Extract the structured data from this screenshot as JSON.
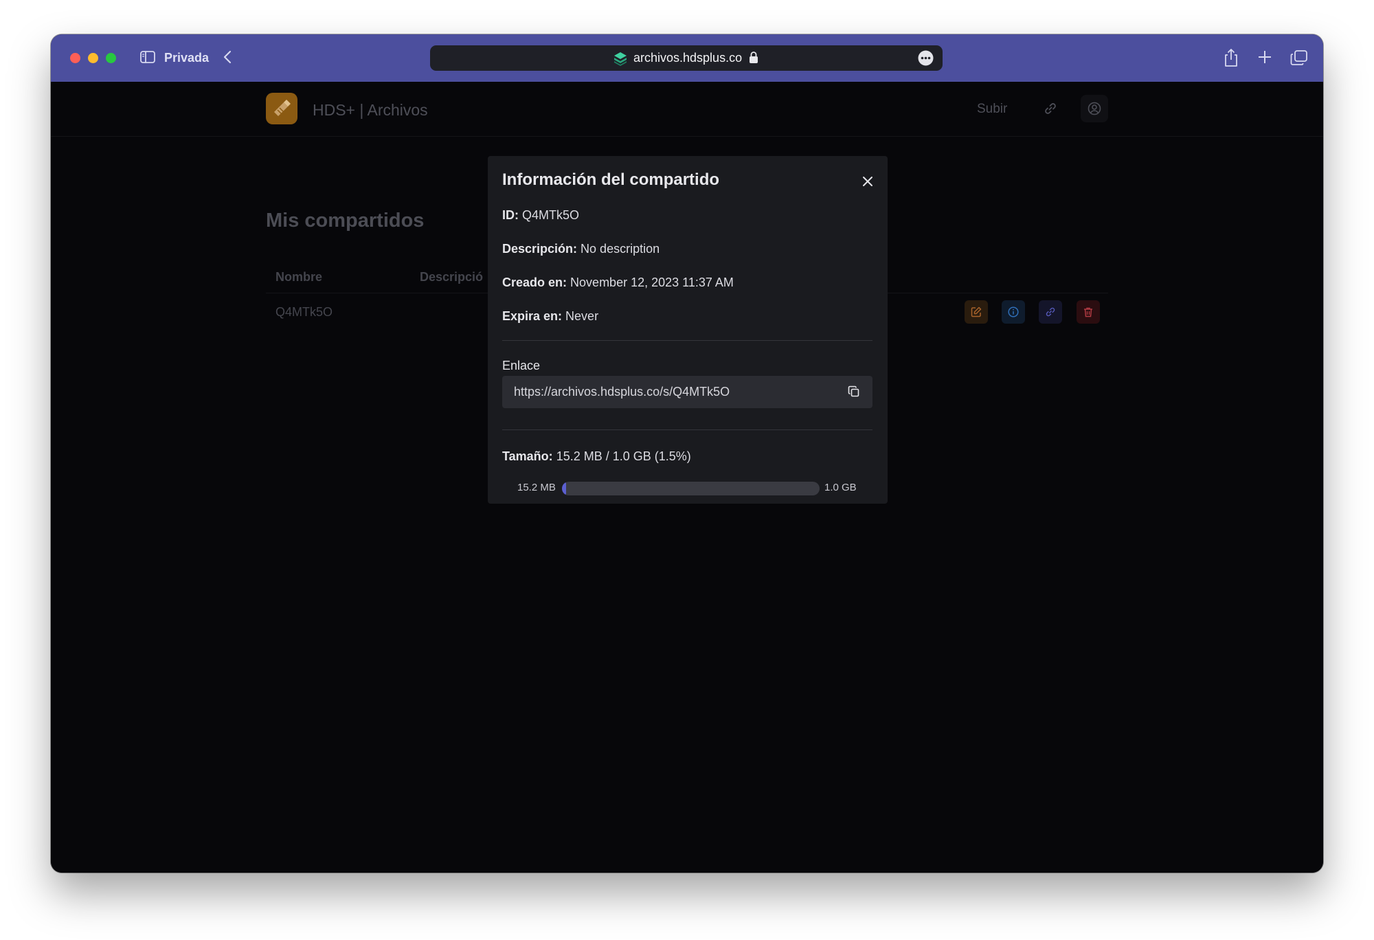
{
  "browser": {
    "private_label": "Privada",
    "url": "archivos.hdsplus.co"
  },
  "app": {
    "brand": "HDS+ | Archivos",
    "nav_upload": "Subir"
  },
  "page": {
    "title": "Mis compartidos",
    "columns": [
      "Nombre",
      "Descripció"
    ],
    "rows": [
      {
        "name": "Q4MTk5O"
      }
    ]
  },
  "modal": {
    "title": "Información del compartido",
    "id_label": "ID:",
    "id_value": "Q4MTk5O",
    "description_label": "Descripción:",
    "description_value": "No description",
    "created_label": "Creado en:",
    "created_value": "November 12, 2023 11:37 AM",
    "expires_label": "Expira en:",
    "expires_value": "Never",
    "link_label": "Enlace",
    "link_value": "https://archivos.hdsplus.co/s/Q4MTk5O",
    "size_label": "Tamaño:",
    "size_value": "15.2 MB / 1.0 GB (1.5%)",
    "bar_min": "15.2 MB",
    "bar_max": "1.0 GB",
    "usage_percent": 1.5
  },
  "colors": {
    "titlebar": "#4c4f9e",
    "accent": "#5b5fd0",
    "modal_bg": "#1a1b1f",
    "page_bg": "#07070a"
  }
}
